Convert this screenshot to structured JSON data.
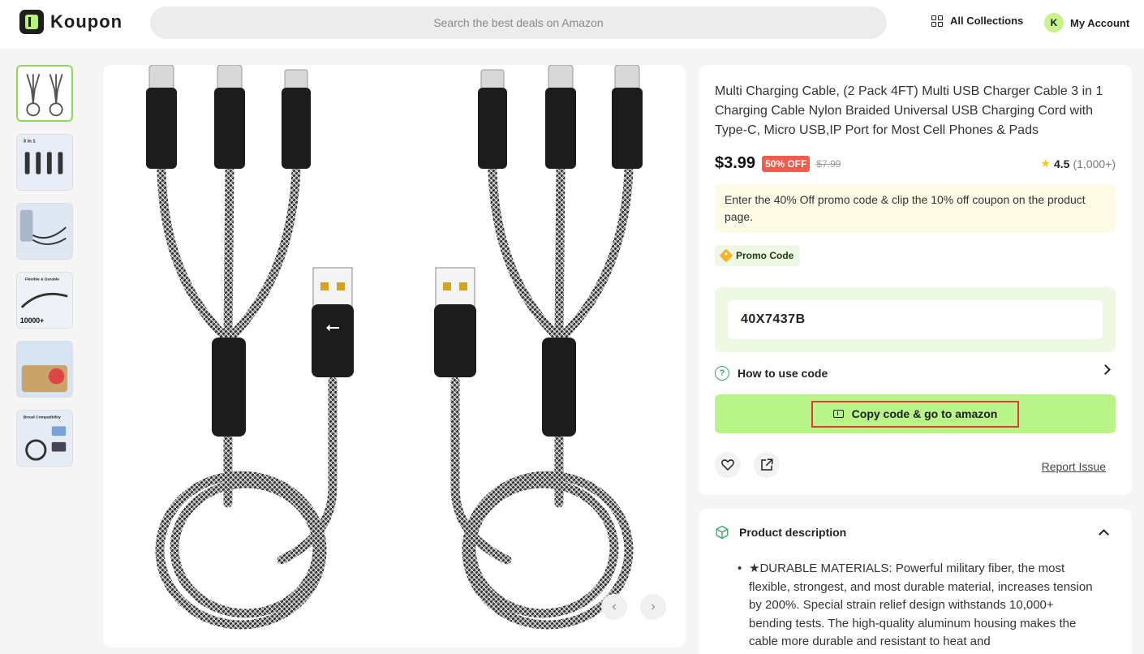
{
  "header": {
    "logo_text": "Koupon",
    "search_placeholder": "Search the best deals on Amazon",
    "collections_label": "All Collections",
    "account_initial": "K",
    "account_label": "My Account"
  },
  "gallery": {
    "thumbnails": [
      {
        "name": "thumb-1",
        "active": true
      },
      {
        "name": "thumb-2",
        "caption": "3 in 1"
      },
      {
        "name": "thumb-3"
      },
      {
        "name": "thumb-4",
        "caption": "Flexible & Durable",
        "badge": "10000+"
      },
      {
        "name": "thumb-5"
      },
      {
        "name": "thumb-6",
        "caption": "Broad Compatibility"
      }
    ],
    "prev_icon": "‹",
    "next_icon": "›"
  },
  "product": {
    "title": "Multi Charging Cable, (2 Pack 4FT) Multi USB Charger Cable 3 in 1 Charging Cable Nylon Braided Universal USB Charging Cord with Type-C, Micro USB,IP Port for Most Cell Phones & Pads",
    "price": "$3.99",
    "discount_badge": "50% OFF",
    "original_price": "$7.99",
    "rating": "4.5",
    "rating_count": "(1,000+)",
    "promo_note": "Enter the 40% Off promo code & clip the 10% off coupon on the product page.",
    "promo_tag_label": "Promo Code",
    "promo_code": "40X7437B",
    "how_to_label": "How to use code",
    "cta_label": "Copy code & go to amazon",
    "report_label": "Report Issue"
  },
  "description": {
    "heading": "Product description",
    "bullets": [
      "★DURABLE MATERIALS: Powerful military fiber, the most flexible, strongest, and most durable material, increases tension by 200%. Special strain relief design withstands 10,000+ bending tests. The high-quality aluminum housing makes the cable more durable and resistant to heat and"
    ]
  },
  "colors": {
    "accent_green": "#b8f487",
    "discount_red": "#f35b4c",
    "highlight_border": "#e03a3a"
  }
}
